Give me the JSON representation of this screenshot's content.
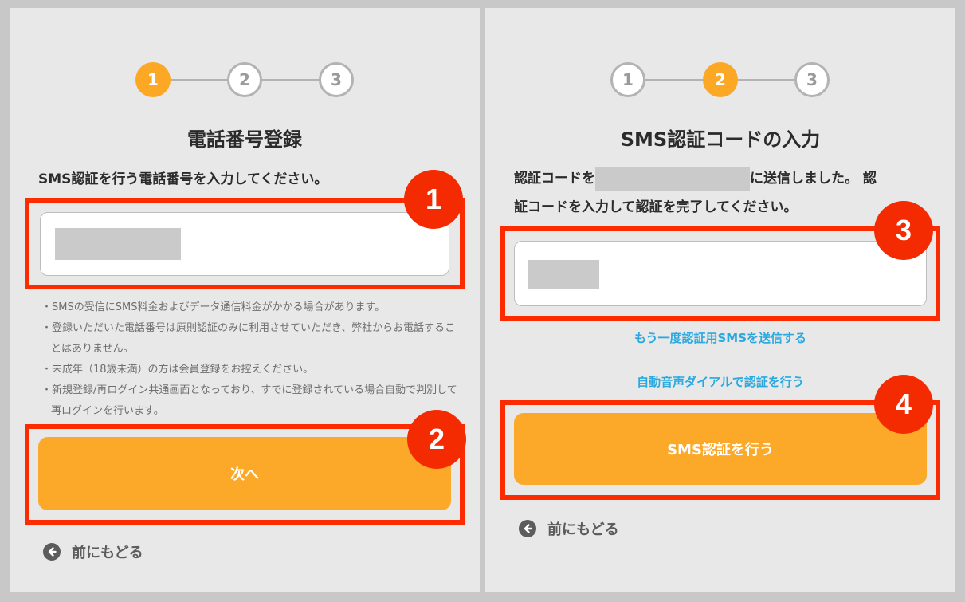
{
  "left": {
    "steps": [
      "1",
      "2",
      "3"
    ],
    "active_step": 1,
    "title": "電話番号登録",
    "instruction": "SMS認証を行う電話番号を入力してください。",
    "notes": [
      "・SMSの受信にSMS料金およびデータ通信料金がかかる場合があります。",
      "・登録いただいた電話番号は原則認証のみに利用させていただき、弊社からお電話することはありません。",
      "・未成年（18歳未満）の方は会員登録をお控えください。",
      "・新規登録/再ログイン共通画面となっており、すでに登録されている場合自動で判別して再ログインを行います。"
    ],
    "next_button": "次へ",
    "back_label": "前にもどる"
  },
  "right": {
    "steps": [
      "1",
      "2",
      "3"
    ],
    "active_step": 2,
    "title": "SMS認証コードの入力",
    "instruction_part1": "認証コードを",
    "instruction_part2": "に送信しました。 認",
    "instruction_line2": "証コードを入力して認証を完了してください。",
    "resend_link": "もう一度認証用SMSを送信する",
    "voice_link": "自動音声ダイアルで認証を行う",
    "submit_button": "SMS認証を行う",
    "back_label": "前にもどる"
  },
  "annotations": [
    "1",
    "2",
    "3",
    "4"
  ],
  "colors": {
    "accent_orange": "#fca824",
    "annotation_red": "#fd2b00",
    "link_blue": "#2aa9e0",
    "panel_bg": "#e8e8e8"
  },
  "icons": {
    "back": "arrow-left-circle-icon"
  }
}
